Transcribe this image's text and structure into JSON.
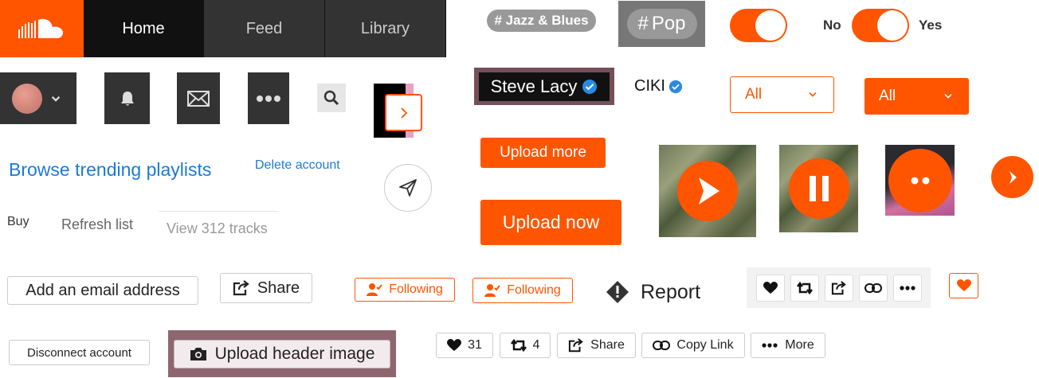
{
  "nav": {
    "tabs": [
      {
        "label": "Home"
      },
      {
        "label": "Feed"
      },
      {
        "label": "Library"
      }
    ]
  },
  "tags": {
    "jazz": "# Jazz & Blues",
    "pop_hash": "#",
    "pop": "Pop"
  },
  "toggles": {
    "no": "No",
    "yes": "Yes"
  },
  "artists": {
    "featured": "Steve Lacy",
    "plain": "CIKI"
  },
  "selects": [
    {
      "value": "All"
    },
    {
      "value": "All"
    }
  ],
  "links": {
    "browse": "Browse trending playlists",
    "delete": "Delete account"
  },
  "buttons": {
    "upload_more": "Upload more",
    "upload_now": "Upload now",
    "add_email": "Add an email address",
    "share": "Share",
    "following_1": "Following",
    "following_2": "Following",
    "report": "Report",
    "disconnect": "Disconnect account",
    "upload_header": "Upload header image"
  },
  "tabs_row": {
    "buy": "Buy",
    "refresh": "Refresh list",
    "view": "View 312 tracks"
  },
  "stats": {
    "likes": "31",
    "reposts": "4",
    "share": "Share",
    "copy_link": "Copy Link",
    "more": "More"
  },
  "colors": {
    "accent": "#ff5500",
    "link": "#1a7ad8",
    "verified": "#2a8ae2"
  }
}
